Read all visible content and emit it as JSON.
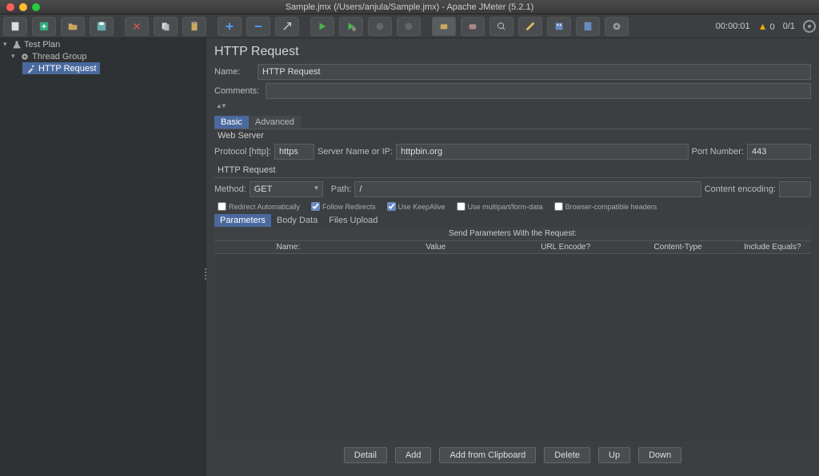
{
  "window": {
    "title": "Sample.jmx (/Users/anjula/Sample.jmx) - Apache JMeter (5.2.1)"
  },
  "toolbar_status": {
    "time": "00:00:01",
    "warnings": "0",
    "threads": "0/1"
  },
  "tree": {
    "items": [
      {
        "label": "Test Plan",
        "level": 0
      },
      {
        "label": "Thread Group",
        "level": 1
      },
      {
        "label": "HTTP Request",
        "level": 2,
        "selected": true
      }
    ]
  },
  "panel": {
    "title": "HTTP Request",
    "name_label": "Name:",
    "name_value": "HTTP Request",
    "comments_label": "Comments:",
    "comments_value": "",
    "tabs": {
      "basic": "Basic",
      "advanced": "Advanced"
    },
    "web_server": {
      "section": "Web Server",
      "protocol_label": "Protocol [http]:",
      "protocol_value": "https",
      "server_label": "Server Name or IP:",
      "server_value": "httpbin.org",
      "port_label": "Port Number:",
      "port_value": "443"
    },
    "http_request": {
      "section": "HTTP Request",
      "method_label": "Method:",
      "method_value": "GET",
      "path_label": "Path:",
      "path_value": "/",
      "encoding_label": "Content encoding:",
      "encoding_value": ""
    },
    "checkboxes": {
      "redirect_auto": "Redirect Automatically",
      "follow_redirects": "Follow Redirects",
      "keepalive": "Use KeepAlive",
      "multipart": "Use multipart/form-data",
      "browser_compat": "Browser-compatible headers"
    },
    "subtabs": {
      "parameters": "Parameters",
      "body": "Body Data",
      "files": "Files Upload"
    },
    "table": {
      "title": "Send Parameters With the Request:",
      "headers": {
        "name": "Name:",
        "value": "Value",
        "url": "URL Encode?",
        "ct": "Content-Type",
        "ie": "Include Equals?"
      }
    },
    "buttons": {
      "detail": "Detail",
      "add": "Add",
      "clipboard": "Add from Clipboard",
      "delete": "Delete",
      "up": "Up",
      "down": "Down"
    }
  }
}
